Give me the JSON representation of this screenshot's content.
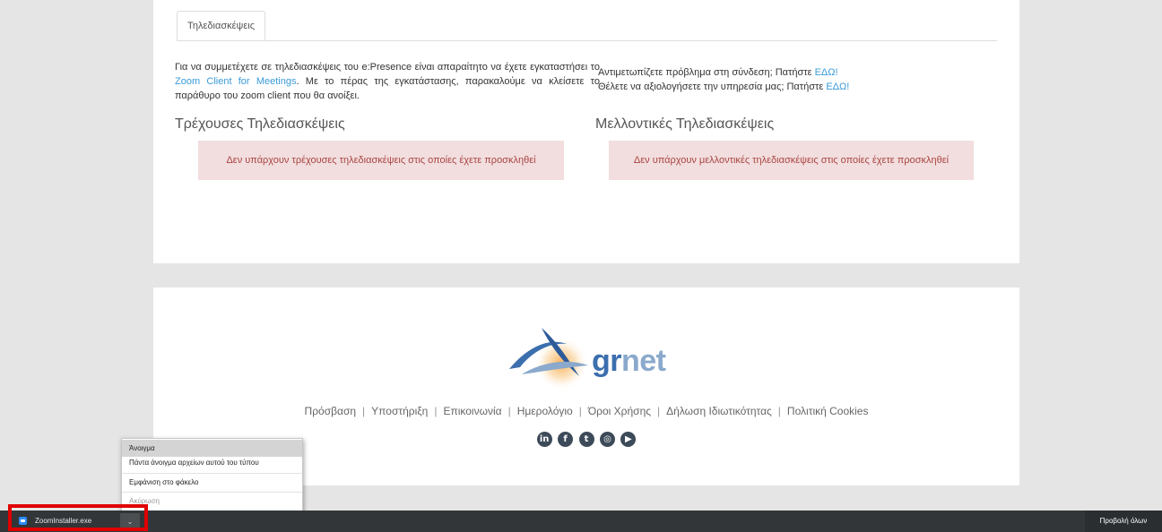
{
  "main": {
    "tab_label": "Τηλεδιασκέψεις",
    "intro_before_link": "Για να συμμετέχετε σε τηλεδιασκέψεις του e:Presence είναι απαραίτητο να έχετε εγκαταστήσει το ",
    "intro_link": "Zoom Client for Meetings",
    "intro_after_link": ". Με το πέρας της εγκατάστασης, παρακαλούμε να κλείσετε το παράθυρο του zoom client που θα ανοίξει.",
    "help_line1_text": "Αντιμετωπίζετε πρόβλημα στη σύνδεση; Πατήστε ",
    "help_line1_link": "ΕΔΩ!",
    "help_line2_text": "Θέλετε να αξιολογήσετε την υπηρεσία μας; Πατήστε ",
    "help_line2_link": "ΕΔΩ!",
    "current_title": "Τρέχουσες Τηλεδιασκέψεις",
    "current_empty": "Δεν υπάρχουν τρέχουσες τηλεδιασκέψεις στις οποίες έχετε προσκληθεί",
    "future_title": "Μελλοντικές Τηλεδιασκέψεις",
    "future_empty": "Δεν υπάρχουν μελλοντικές τηλεδιασκέψεις στις οποίες έχετε προσκληθεί"
  },
  "footer": {
    "logo_gr": "gr",
    "logo_net": "net",
    "links": [
      "Πρόσβαση",
      "Υποστήριξη",
      "Επικοινωνία",
      "Ημερολόγιο",
      "Όροι Χρήσης",
      "Δήλωση Ιδιωτικότητας",
      "Πολιτική Cookies"
    ],
    "separator": "|",
    "socials": [
      {
        "icon": "linkedin-icon",
        "glyph": "in"
      },
      {
        "icon": "facebook-icon",
        "glyph": "f"
      },
      {
        "icon": "twitter-icon",
        "glyph": "t"
      },
      {
        "icon": "instagram-icon",
        "glyph": "◎"
      },
      {
        "icon": "youtube-icon",
        "glyph": "▶"
      }
    ]
  },
  "context_menu": {
    "open": "Άνοιγμα",
    "always_open": "Πάντα άνοιγμα αρχείων αυτού του τύπου",
    "show_in_folder": "Εμφάνιση στο φάκελο",
    "cancel": "Ακύρωση"
  },
  "download_bar": {
    "file_name": "ZoomInstaller.exe",
    "chevron": "⌄",
    "view_all": "Προβολή όλων"
  },
  "colors": {
    "link": "#3a9ad9",
    "alert_bg": "#f2dede",
    "alert_text": "#a94442",
    "highlight": "#e00000"
  }
}
